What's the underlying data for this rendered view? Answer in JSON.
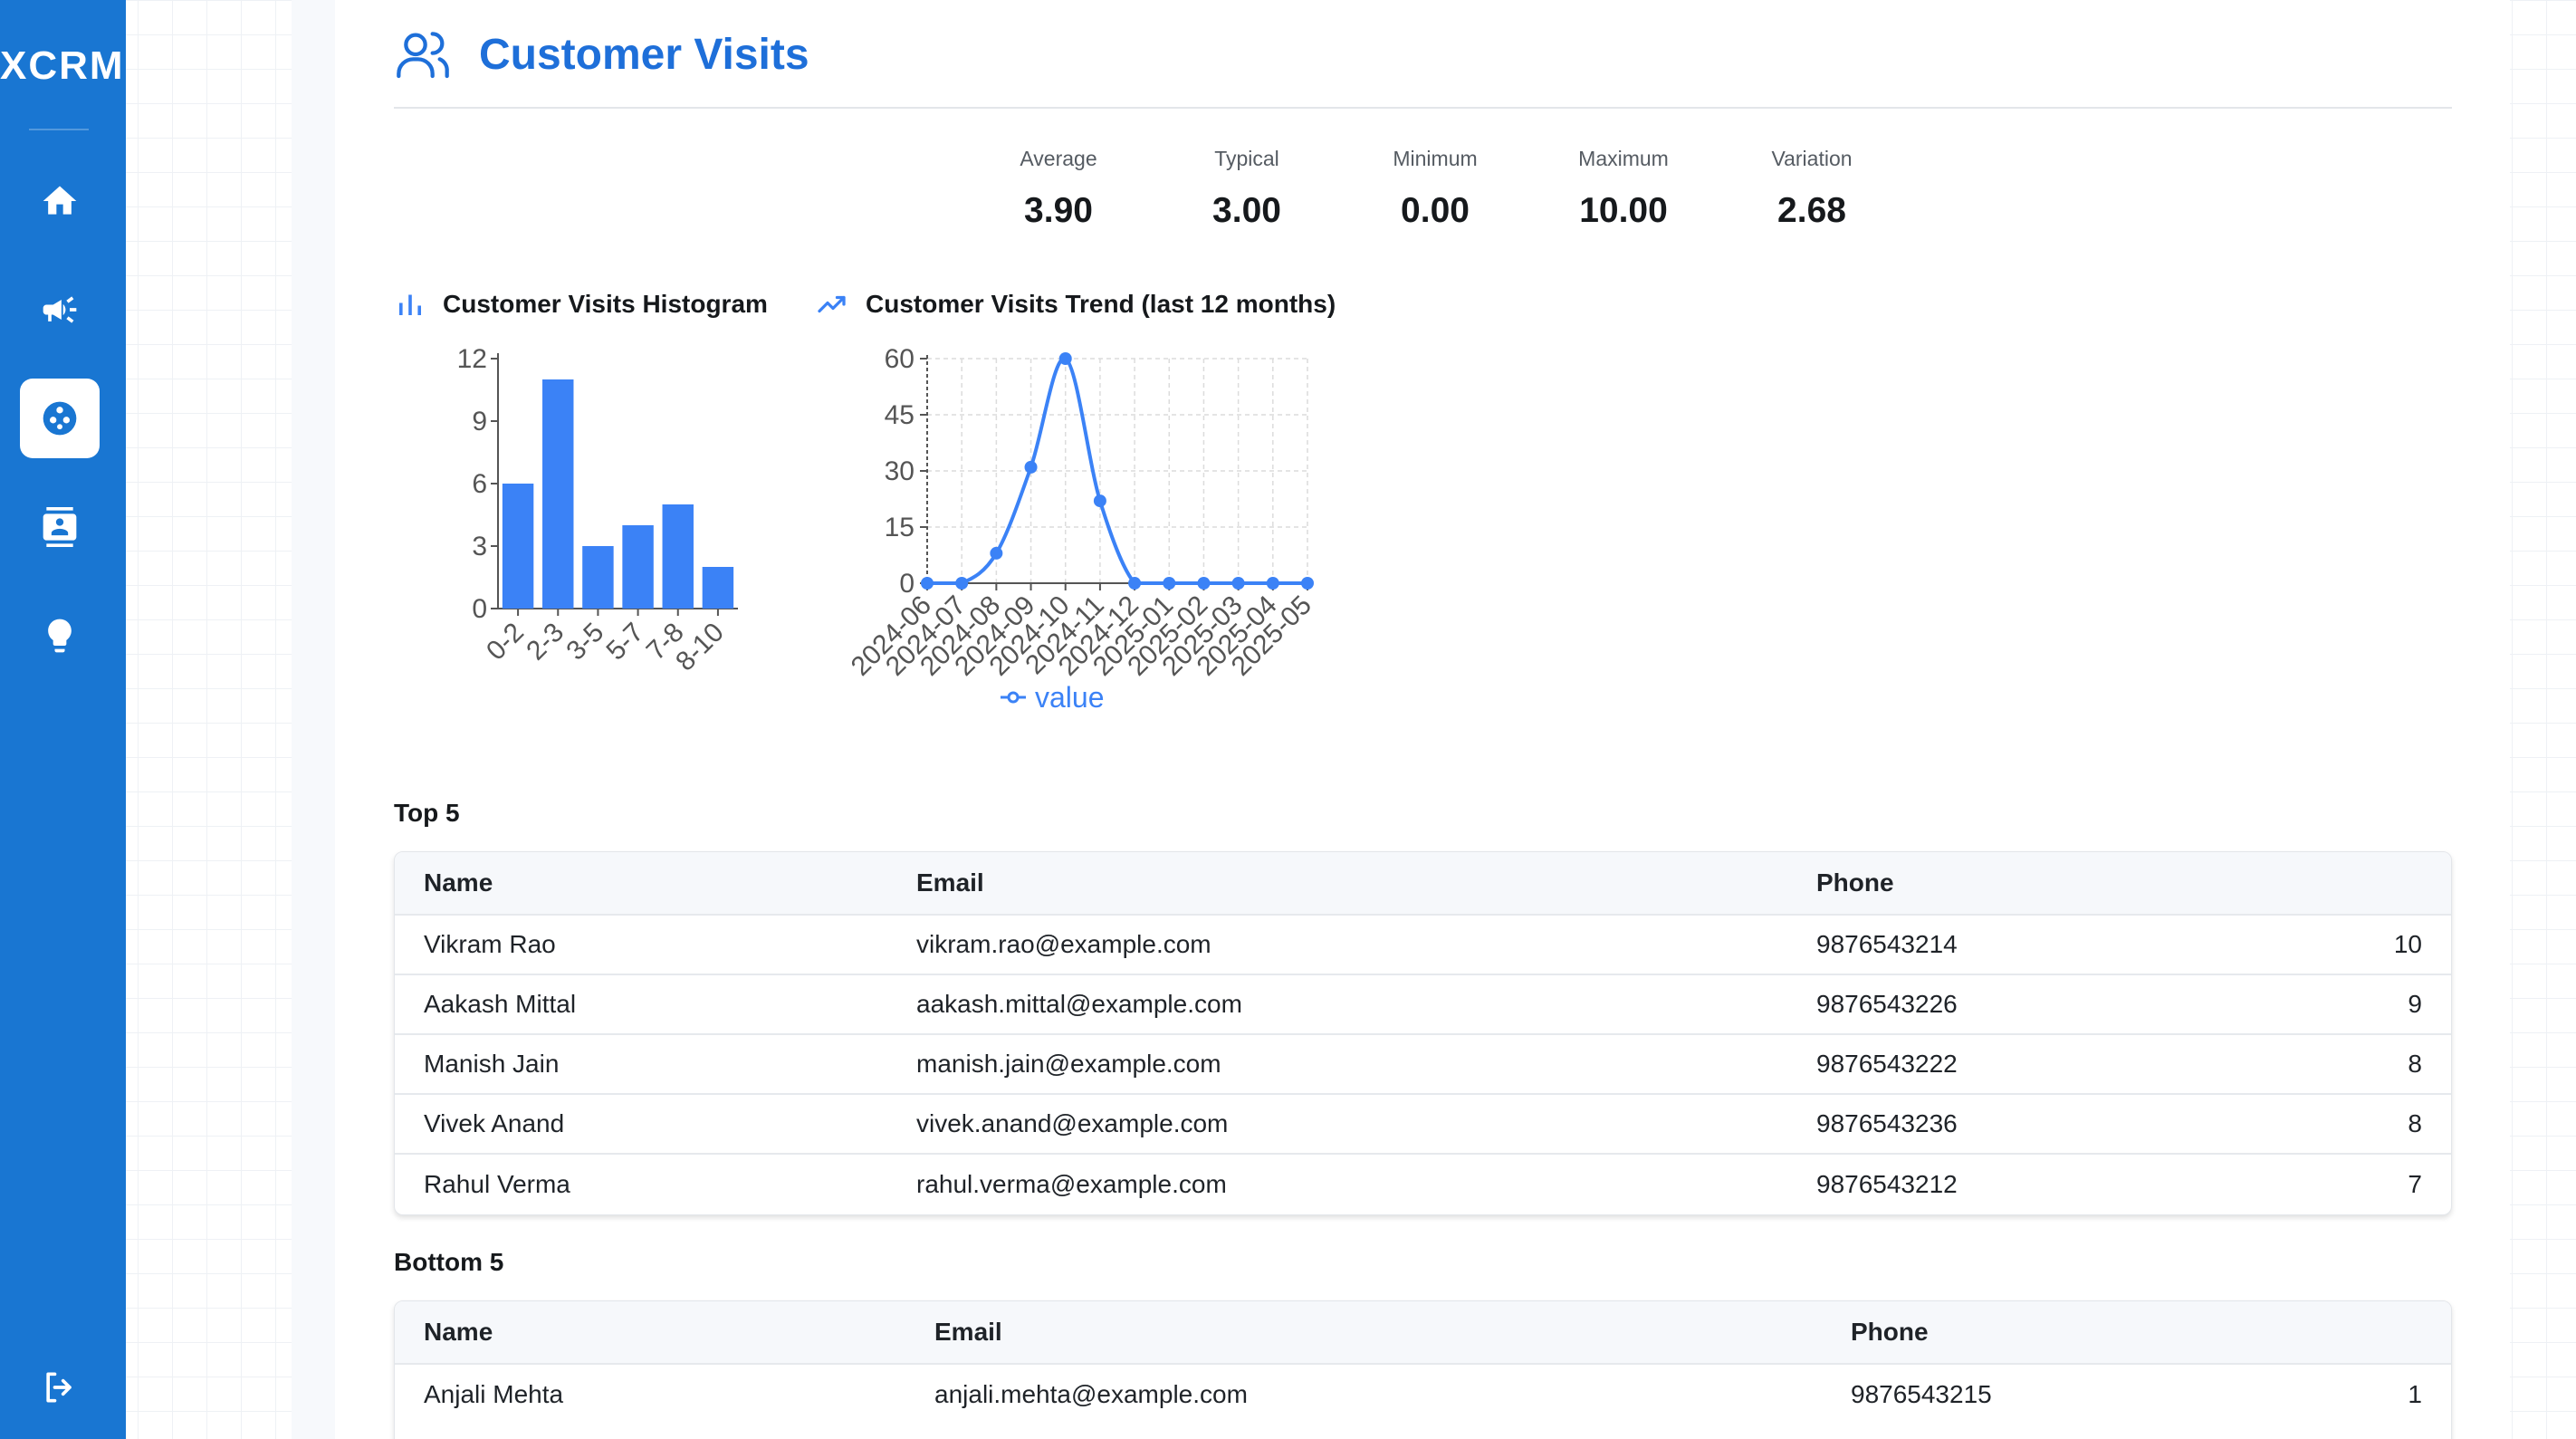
{
  "app": {
    "name": "XCRM"
  },
  "sidebar": {
    "items": [
      {
        "icon": "home-icon",
        "active": false
      },
      {
        "icon": "megaphone-icon",
        "active": false
      },
      {
        "icon": "customer-visits-icon",
        "active": true
      },
      {
        "icon": "contacts-icon",
        "active": false
      },
      {
        "icon": "lightbulb-icon",
        "active": false
      }
    ],
    "logout_icon": "logout-icon"
  },
  "page": {
    "title": "Customer Visits",
    "icon": "users-icon"
  },
  "stats": [
    {
      "label": "Average",
      "value": "3.90"
    },
    {
      "label": "Typical",
      "value": "3.00"
    },
    {
      "label": "Minimum",
      "value": "0.00"
    },
    {
      "label": "Maximum",
      "value": "10.00"
    },
    {
      "label": "Variation",
      "value": "2.68"
    }
  ],
  "charts": {
    "histogram_title": "Customer Visits Histogram",
    "trend_title": "Customer Visits Trend (last 12 months)"
  },
  "chart_data": [
    {
      "type": "bar",
      "title": "Customer Visits Histogram",
      "categories": [
        "0-2",
        "2-3",
        "3-5",
        "5-7",
        "7-8",
        "8-10"
      ],
      "values": [
        6,
        11,
        3,
        4,
        5,
        2
      ],
      "ylim": [
        0,
        12
      ],
      "yticks": [
        0,
        3,
        6,
        9,
        12
      ],
      "color": "#3b82f6"
    },
    {
      "type": "line",
      "title": "Customer Visits Trend (last 12 months)",
      "x": [
        "2024-06",
        "2024-07",
        "2024-08",
        "2024-09",
        "2024-10",
        "2024-11",
        "2024-12",
        "2025-01",
        "2025-02",
        "2025-03",
        "2025-04",
        "2025-05"
      ],
      "series": [
        {
          "name": "value",
          "values": [
            0,
            0,
            8,
            31,
            60,
            22,
            0,
            0,
            0,
            0,
            0,
            0
          ]
        }
      ],
      "ylim": [
        0,
        60
      ],
      "yticks": [
        0,
        15,
        30,
        45,
        60
      ],
      "grid": true,
      "legend": "bottom",
      "color": "#3b82f6"
    }
  ],
  "top5": {
    "title": "Top 5",
    "headers": {
      "name": "Name",
      "email": "Email",
      "phone": "Phone"
    },
    "rows": [
      {
        "name": "Vikram Rao",
        "email": "vikram.rao@example.com",
        "phone": "9876543214",
        "visits": "10"
      },
      {
        "name": "Aakash Mittal",
        "email": "aakash.mittal@example.com",
        "phone": "9876543226",
        "visits": "9"
      },
      {
        "name": "Manish Jain",
        "email": "manish.jain@example.com",
        "phone": "9876543222",
        "visits": "8"
      },
      {
        "name": "Vivek Anand",
        "email": "vivek.anand@example.com",
        "phone": "9876543236",
        "visits": "8"
      },
      {
        "name": "Rahul Verma",
        "email": "rahul.verma@example.com",
        "phone": "9876543212",
        "visits": "7"
      }
    ]
  },
  "bottom5": {
    "title": "Bottom 5",
    "headers": {
      "name": "Name",
      "email": "Email",
      "phone": "Phone"
    },
    "rows": [
      {
        "name": "Anjali Mehta",
        "email": "anjali.mehta@example.com",
        "phone": "9876543215",
        "visits": "1"
      }
    ]
  }
}
